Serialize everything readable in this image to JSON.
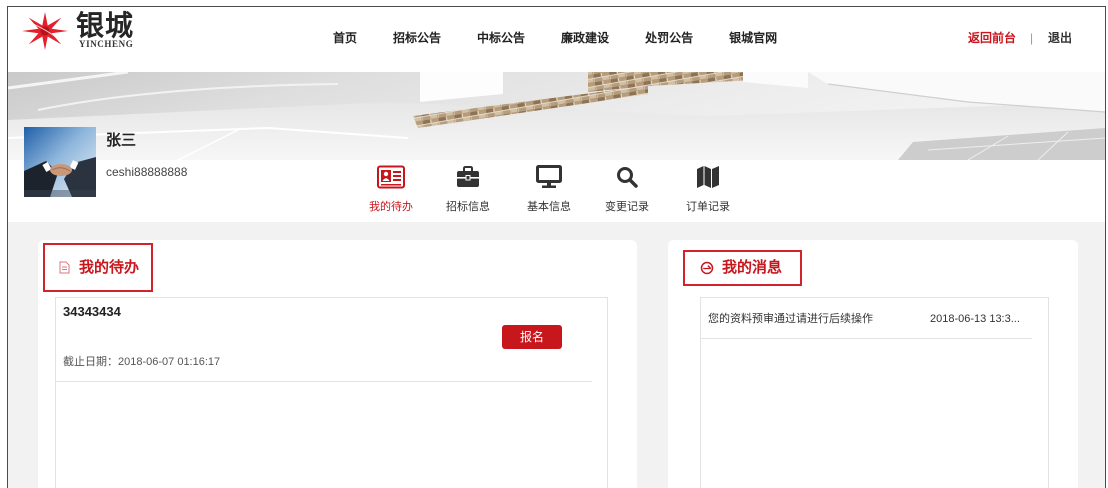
{
  "logo": {
    "name": "银城",
    "sub": "YINCHENG",
    "icon": "logo-star-icon"
  },
  "nav": [
    {
      "label": "首页"
    },
    {
      "label": "招标公告"
    },
    {
      "label": "中标公告"
    },
    {
      "label": "廉政建设"
    },
    {
      "label": "处罚公告"
    },
    {
      "label": "银城官网"
    }
  ],
  "header_right": {
    "back_label": "返回前台",
    "separator": "|",
    "logout_label": "退出"
  },
  "user": {
    "name": "张三",
    "account": "ceshi88888888",
    "avatar_icon": "handshake-avatar"
  },
  "tabs": [
    {
      "label": "我的待办",
      "icon": "id-card-icon",
      "active": true
    },
    {
      "label": "招标信息",
      "icon": "briefcase-icon",
      "active": false
    },
    {
      "label": "基本信息",
      "icon": "monitor-icon",
      "active": false
    },
    {
      "label": "变更记录",
      "icon": "search-icon",
      "active": false
    },
    {
      "label": "订单记录",
      "icon": "map-icon",
      "active": false
    }
  ],
  "todo": {
    "title": "我的待办",
    "icon": "document-icon",
    "items": [
      {
        "name": "34343434",
        "action_label": "报名",
        "deadline": "截止日期：2018-06-07 01:16:17"
      }
    ]
  },
  "messages": {
    "title": "我的消息",
    "icon": "message-circle-icon",
    "items": [
      {
        "text": "您的资料预审通过请进行后续操作",
        "time": "2018-06-13 13:3..."
      }
    ]
  },
  "colors": {
    "accent": "#c8161d",
    "highlight_box": "#d4222c",
    "text": "#333333",
    "panel_background": "#f2f2f2",
    "card_background": "#ffffff"
  }
}
